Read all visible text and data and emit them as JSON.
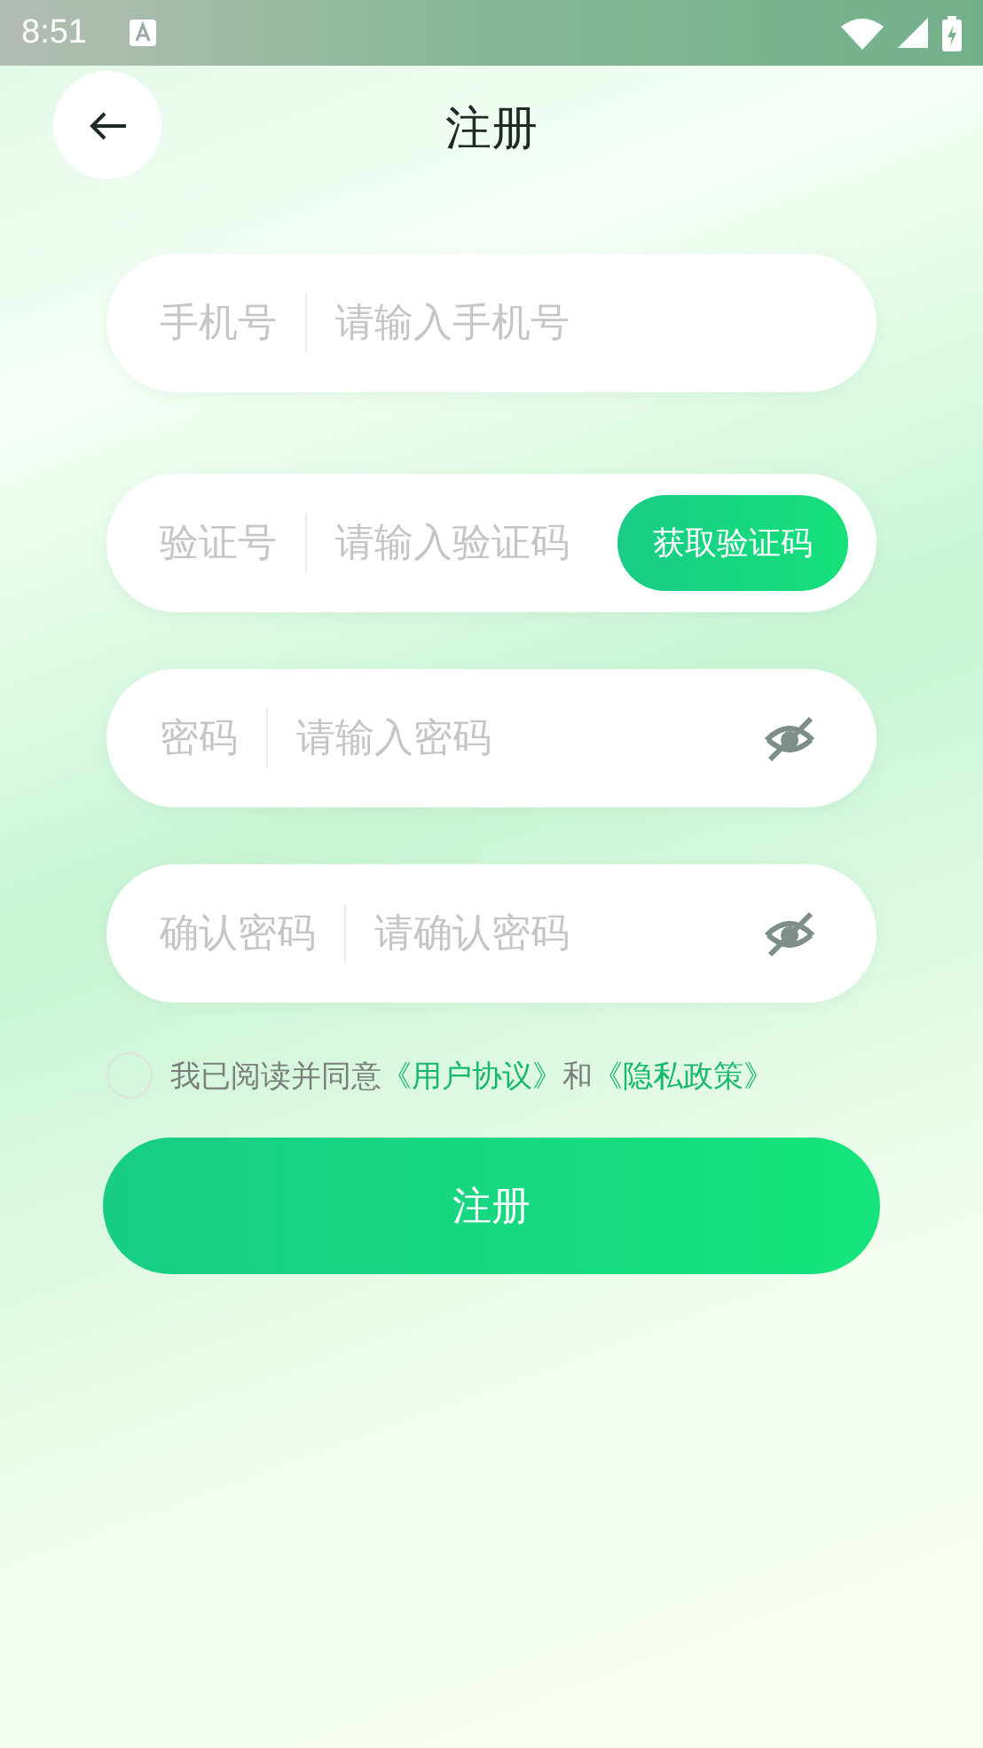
{
  "status_bar": {
    "time": "8:51"
  },
  "header": {
    "title": "注册"
  },
  "fields": [
    {
      "kind": "plain",
      "label": "手机号",
      "placeholder": "请输入手机号"
    },
    {
      "kind": "code",
      "label": "验证号",
      "placeholder": "请输入验证码",
      "button": "获取验证码"
    },
    {
      "kind": "password",
      "label": "密码",
      "placeholder": "请输入密码",
      "show_password": false
    },
    {
      "kind": "password",
      "label": "确认密码",
      "placeholder": "请确认密码",
      "show_password": false
    }
  ],
  "agreement": {
    "checked": false,
    "parts": [
      {
        "kind": "text",
        "text": "我已阅读并同意"
      },
      {
        "kind": "link",
        "text": "《用户协议》"
      },
      {
        "kind": "text",
        "text": "和"
      },
      {
        "kind": "link",
        "text": "《隐私政策》"
      }
    ]
  },
  "submit": {
    "label": "注册"
  }
}
